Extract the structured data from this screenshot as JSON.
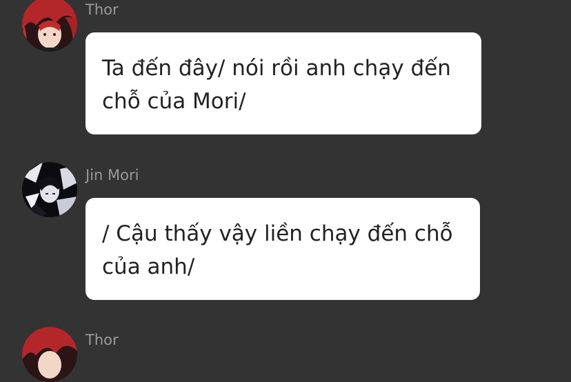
{
  "colors": {
    "background": "#333333",
    "bubble": "#ffffff",
    "sender_name": "#9a9a9a",
    "message_text": "#222222"
  },
  "messages": [
    {
      "sender": "Thor",
      "avatar": "red-haired-character-avatar",
      "text": "Ta đến đây/ nói rồi anh chạy đến chỗ của Mori/"
    },
    {
      "sender": "Jin Mori",
      "avatar": "dark-haired-character-avatar",
      "text": "/ Cậu thấy vậy liền chạy đến chỗ của anh/"
    },
    {
      "sender": "Thor",
      "avatar": "red-haired-character-avatar",
      "text": ""
    }
  ]
}
